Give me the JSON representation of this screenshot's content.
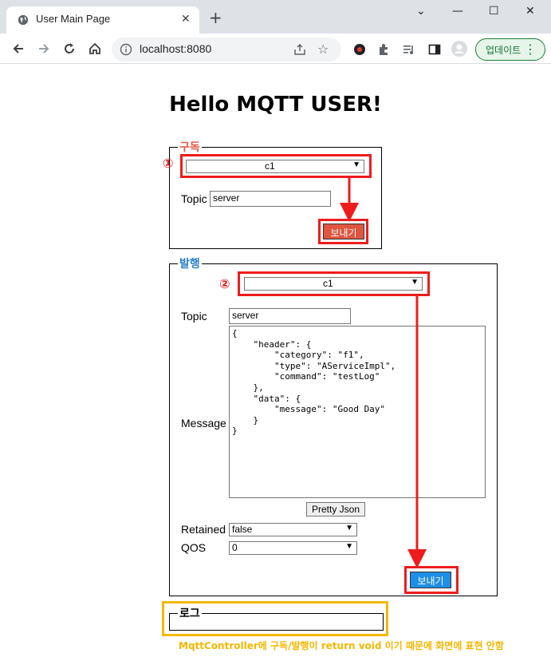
{
  "browser": {
    "tab_title": "User Main Page",
    "tab_close": "✕",
    "new_tab": "+",
    "url": "localhost:8080",
    "update_label": "업데이트",
    "window_controls": {
      "minimize": "—",
      "maximize": "☐",
      "close": "✕",
      "dropdown": "⌄"
    }
  },
  "page": {
    "title": "Hello MQTT USER!",
    "subscribe": {
      "legend": "구독",
      "client_selected": "c1",
      "topic_label": "Topic",
      "topic_value": "server",
      "send_label": "보내기",
      "marker": "①"
    },
    "publish": {
      "legend": "발행",
      "client_selected": "c1",
      "topic_label": "Topic",
      "topic_value": "server",
      "message_label": "Message",
      "message_value": "{\n    \"header\": {\n        \"category\": \"f1\",\n        \"type\": \"AServiceImpl\",\n        \"command\": \"testLog\"\n    },\n    \"data\": {\n        \"message\": \"Good Day\"\n    }\n}",
      "pretty_json_label": "Pretty Json",
      "retained_label": "Retained",
      "retained_selected": "false",
      "qos_label": "QOS",
      "qos_selected": "0",
      "send_label": "보내기",
      "marker": "②"
    },
    "log": {
      "legend": "로그",
      "note": "MqttController에 구독/발행이 return void 이기 때문에 화면에 표현 안함"
    }
  },
  "colors": {
    "annotation_red": "#ee1c1c",
    "annotation_yellow": "#f6b700",
    "subscribe_button": "#e0553f",
    "publish_button": "#1e8fe6"
  }
}
